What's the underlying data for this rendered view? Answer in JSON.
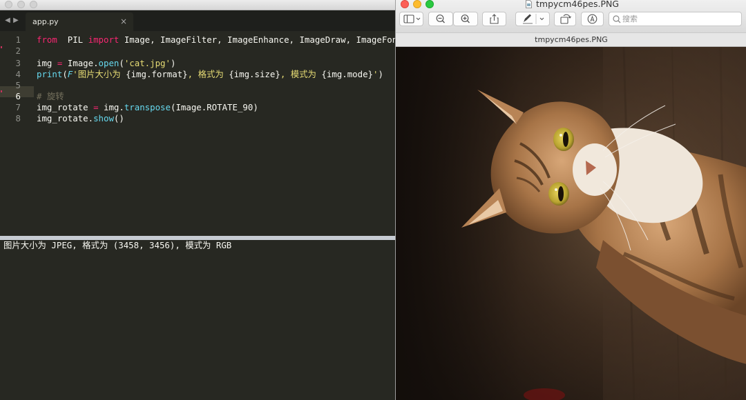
{
  "editor": {
    "tab_label": "app.py",
    "tab_close": "×",
    "current_line": 6,
    "code_lines": [
      {
        "num": "1",
        "segments": [
          [
            "kw",
            "from"
          ],
          [
            "",
            "  PIL "
          ],
          [
            "kw",
            "import"
          ],
          [
            "",
            " Image, ImageFilter, ImageEnhance, ImageDraw, ImageFont"
          ]
        ]
      },
      {
        "num": "2",
        "segments": []
      },
      {
        "num": "3",
        "segments": [
          [
            "",
            "img "
          ],
          [
            "kw",
            "="
          ],
          [
            "",
            " Image."
          ],
          [
            "fn",
            "open"
          ],
          [
            "",
            "("
          ],
          [
            "str",
            "'cat.jpg'"
          ],
          [
            "",
            ")"
          ]
        ]
      },
      {
        "num": "4",
        "segments": [
          [
            "fn",
            "print"
          ],
          [
            "",
            "("
          ],
          [
            "it",
            "F"
          ],
          [
            "str",
            "'图片大小为 "
          ],
          [
            "",
            "{img.format}"
          ],
          [
            "str",
            ", 格式为 "
          ],
          [
            "",
            "{img.size}"
          ],
          [
            "str",
            ", 模式为 "
          ],
          [
            "",
            "{img.mode}"
          ],
          [
            "str",
            "'"
          ],
          [
            "",
            ")"
          ]
        ]
      },
      {
        "num": "5",
        "segments": []
      },
      {
        "num": "6",
        "segments": [
          [
            "cm",
            "# 旋转"
          ]
        ]
      },
      {
        "num": "7",
        "segments": [
          [
            "",
            "img_rotate "
          ],
          [
            "kw",
            "="
          ],
          [
            "",
            " img."
          ],
          [
            "fn",
            "transpose"
          ],
          [
            "",
            "(Image.ROTATE_90)"
          ]
        ]
      },
      {
        "num": "8",
        "segments": [
          [
            "",
            "img_rotate."
          ],
          [
            "fn",
            "show"
          ],
          [
            "",
            "()"
          ]
        ]
      }
    ],
    "console_output": "图片大小为 JPEG, 格式为 (3458, 3456), 模式为 RGB"
  },
  "preview": {
    "window_title": "tmpycm46pes.PNG",
    "doc_title": "tmpycm46pes.PNG",
    "search_placeholder": "搜索"
  },
  "colors": {
    "editor_bg": "#272822",
    "keyword": "#f92672",
    "function": "#66d9ef",
    "string": "#e6db74",
    "comment": "#75715e",
    "tl_close": "#fc5f57",
    "tl_min": "#fdbc2e",
    "tl_max": "#2ac940"
  }
}
